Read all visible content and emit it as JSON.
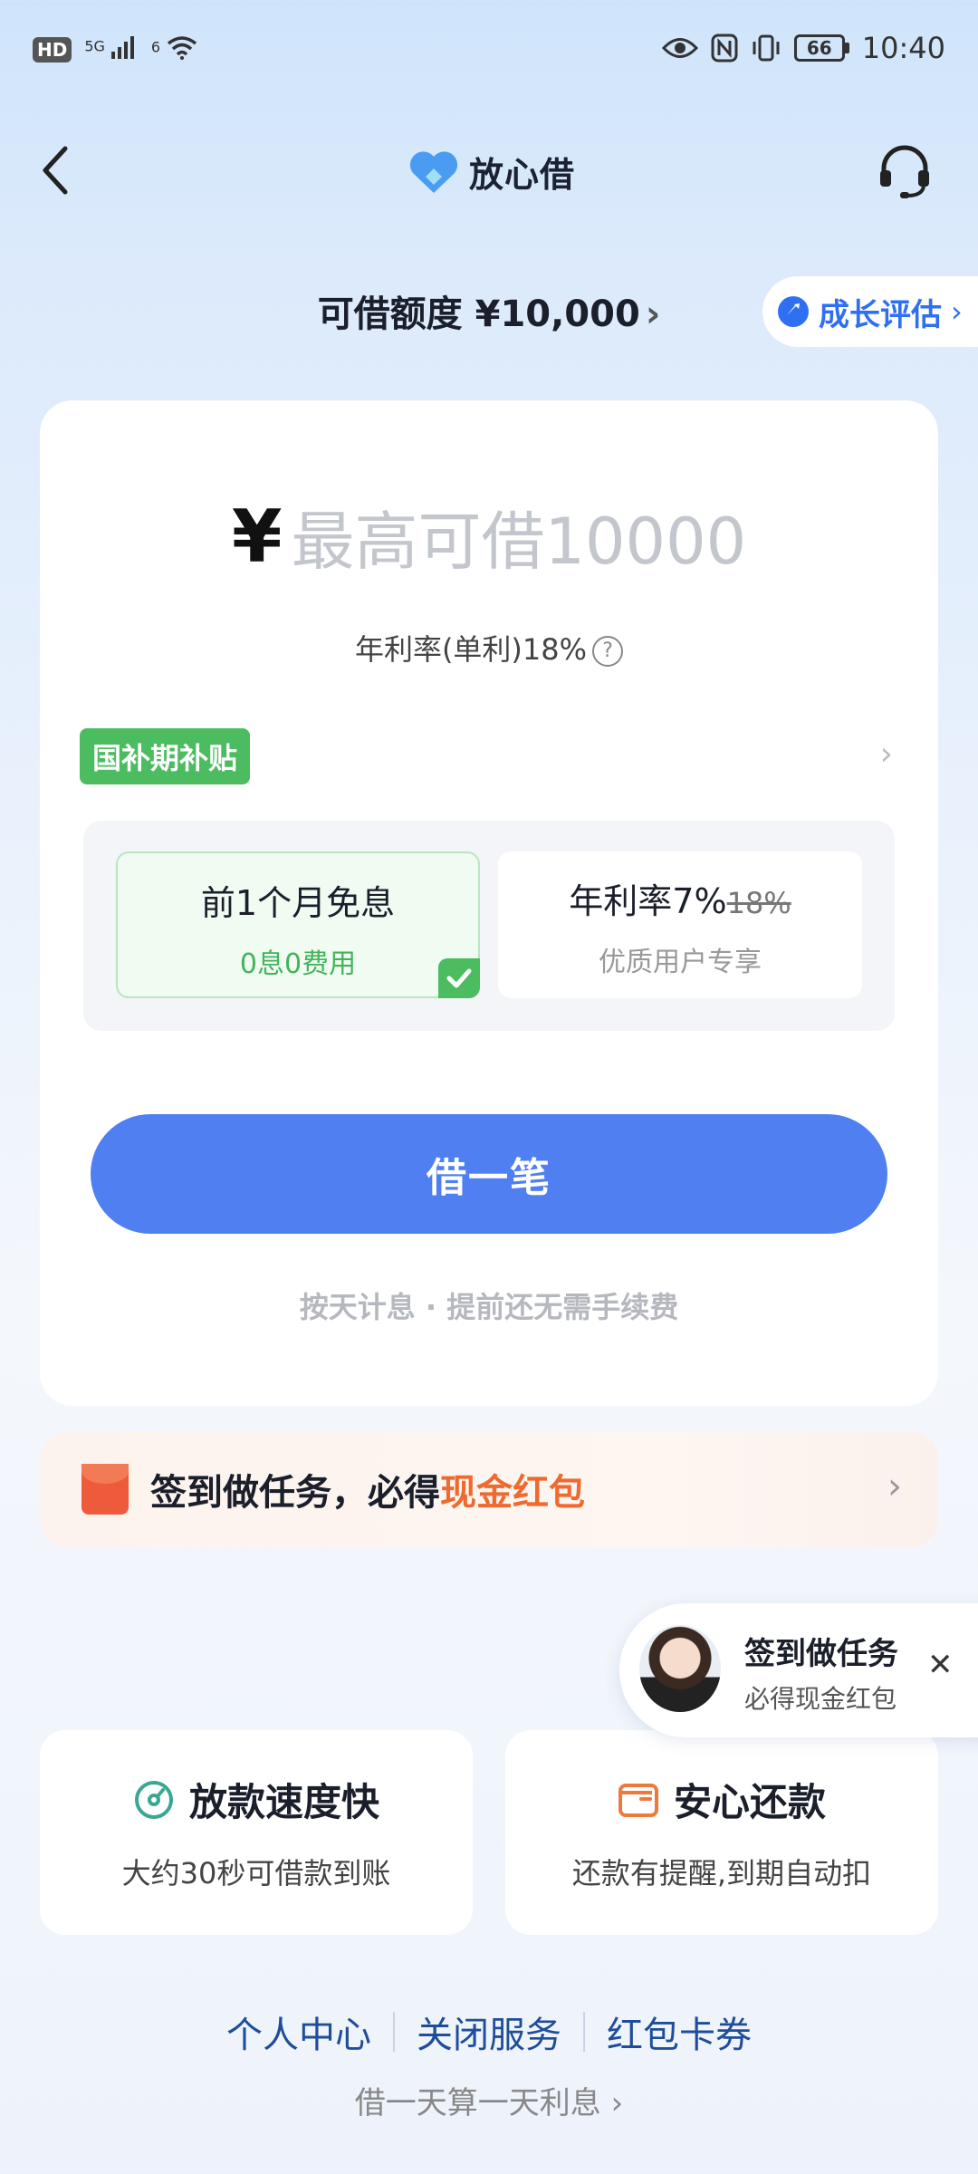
{
  "status_bar": {
    "hd": "HD",
    "signal_1": "5G",
    "signal_2": "6",
    "battery": "66",
    "time": "10:40"
  },
  "nav": {
    "brand": "放心借"
  },
  "credit": {
    "label": "可借额度 ¥10,000",
    "growth_label": "成长评估"
  },
  "card": {
    "currency": "¥",
    "amount_placeholder": "最高可借10000",
    "rate_text": "年利率(单利)18%",
    "subsidy_tag": "国补期补贴",
    "offers": [
      {
        "title": "前1个月免息",
        "subtitle": "0息0费用"
      },
      {
        "title": "年利率7%",
        "strike": "18%",
        "subtitle": "优质用户专享"
      }
    ],
    "borrow_button": "借一笔",
    "tip": "按天计息 · 提前还无需手续费"
  },
  "task_banner": {
    "text": "签到做任务，必得",
    "highlight": "现金红包"
  },
  "float_popup": {
    "title": "签到做任务",
    "subtitle": "必得现金红包"
  },
  "features": [
    {
      "title": "放款速度快",
      "desc": "大约30秒可借款到账"
    },
    {
      "title": "安心还款",
      "desc": "还款有提醒,到期自动扣"
    }
  ],
  "footer": {
    "links": [
      "个人中心",
      "关闭服务",
      "红包卡券"
    ],
    "note": "借一天算一天利息"
  },
  "colors": {
    "primary": "#4f7ff0",
    "green": "#4cbc60",
    "orange": "#ee6a2f",
    "link": "#1f4d99"
  }
}
